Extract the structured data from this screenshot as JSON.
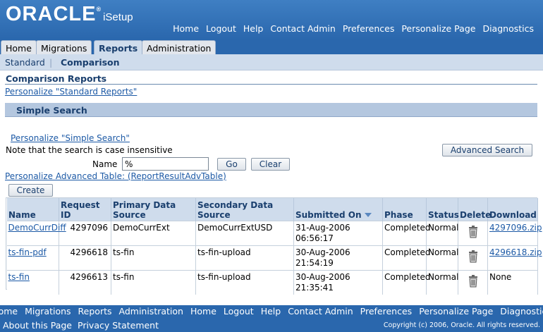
{
  "header": {
    "logo_text": "ORACLE",
    "logo_reg": "®",
    "app_name": "iSetup",
    "global_links": [
      "Home",
      "Logout",
      "Help",
      "Contact Admin",
      "Preferences",
      "Personalize Page",
      "Diagnostics"
    ]
  },
  "tabs": [
    {
      "label": "Home",
      "active": false
    },
    {
      "label": "Migrations",
      "active": false
    },
    {
      "label": "Reports",
      "active": true
    },
    {
      "label": "Administration",
      "active": false
    }
  ],
  "subtabs": {
    "standard": "Standard",
    "separator": "|",
    "comparison": "Comparison"
  },
  "page": {
    "title": "Comparison Reports",
    "personalize_standard": "Personalize \"Standard Reports\""
  },
  "search": {
    "panel_title": "Simple Search",
    "personalize_simple": "Personalize \"Simple Search\"",
    "note": "Note that the search is case insensitive",
    "advanced_button": "Advanced Search",
    "name_label": "Name",
    "name_value": "%",
    "go_button": "Go",
    "clear_button": "Clear"
  },
  "table": {
    "personalize_adv": "Personalize Advanced Table: (ReportResultAdvTable)",
    "create_button": "Create",
    "columns": [
      "Name",
      "Request ID",
      "Primary Data Source",
      "Secondary Data Source",
      "Submitted On",
      "Phase",
      "Status",
      "Delete",
      "Download"
    ],
    "rows": [
      {
        "name": "DemoCurrDiff",
        "request_id": "4297096",
        "primary": "DemoCurrExt",
        "secondary": "DemoCurrExtUSD",
        "submitted": "31-Aug-2006 06:56:17",
        "phase": "Completed",
        "status": "Normal",
        "download": "4297096.zip",
        "download_is_link": true
      },
      {
        "name": "ts-fin-pdf",
        "request_id": "4296618",
        "primary": "ts-fin",
        "secondary": "ts-fin-upload",
        "submitted": "30-Aug-2006 21:54:19",
        "phase": "Completed",
        "status": "Normal",
        "download": "4296618.zip",
        "download_is_link": true
      },
      {
        "name": "ts-fin",
        "request_id": "4296613",
        "primary": "ts-fin",
        "secondary": "ts-fin-upload",
        "submitted": "30-Aug-2006 21:35:41",
        "phase": "Completed",
        "status": "Normal",
        "download": "None",
        "download_is_link": false
      }
    ]
  },
  "footer": {
    "links": [
      "Home",
      "Migrations",
      "Reports",
      "Administration",
      "Home",
      "Logout",
      "Help",
      "Contact Admin",
      "Preferences",
      "Personalize Page",
      "Diagnostics"
    ],
    "about": "About this Page",
    "privacy": "Privacy Statement",
    "copyright": "Copyright (c) 2006, Oracle. All rights reserved."
  },
  "colors": {
    "header_blue": "#2a67ad",
    "link_blue": "#1d5aa6",
    "panel_blue": "#b4c7df",
    "heading_navy": "#1a3f6e"
  }
}
